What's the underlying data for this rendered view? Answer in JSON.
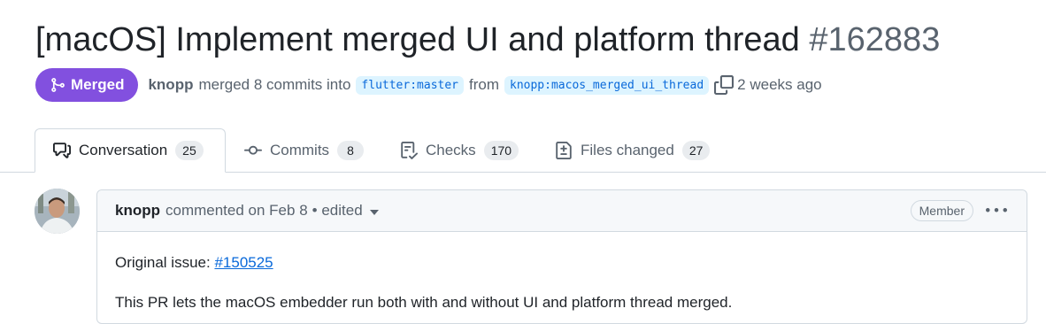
{
  "pr": {
    "title": "[macOS] Implement merged UI and platform thread",
    "number": "#162883",
    "state": "Merged",
    "author": "knopp",
    "merged_text": "merged 8 commits into",
    "base_branch": "flutter:master",
    "from_text": "from",
    "head_branch": "knopp:macos_merged_ui_thread",
    "time_ago": "2 weeks ago"
  },
  "tabs": [
    {
      "label": "Conversation",
      "count": "25",
      "icon": "comment-discussion-icon"
    },
    {
      "label": "Commits",
      "count": "8",
      "icon": "git-commit-icon"
    },
    {
      "label": "Checks",
      "count": "170",
      "icon": "checklist-icon"
    },
    {
      "label": "Files changed",
      "count": "27",
      "icon": "file-diff-icon"
    }
  ],
  "comment": {
    "author": "knopp",
    "commented_text": "commented on Feb 8",
    "edited_text": "• edited",
    "role_badge": "Member",
    "issue_label": "Original issue:",
    "issue_link": "#150525",
    "body": "This PR lets the macOS embedder run both with and without UI and platform thread merged."
  },
  "colors": {
    "merged": "#8250df",
    "link": "#0969da",
    "branch_bg": "#ddf4ff"
  }
}
